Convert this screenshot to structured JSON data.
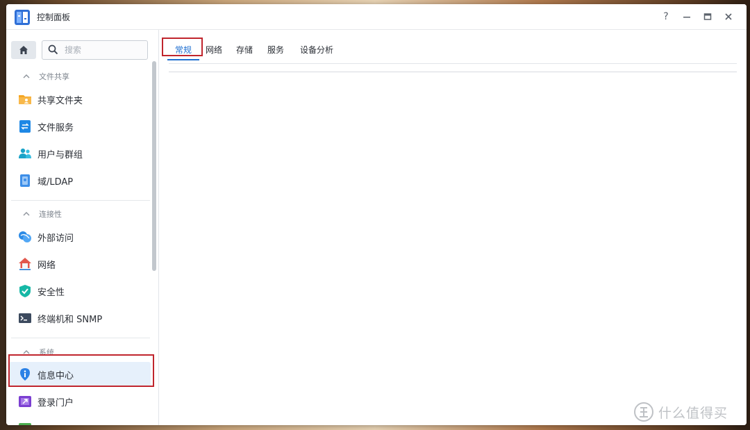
{
  "window": {
    "title": "控制面板",
    "help_label": "?"
  },
  "search": {
    "placeholder": "搜索"
  },
  "sidebar": {
    "sections": [
      {
        "title": "文件共享",
        "items": [
          {
            "label": "共享文件夹",
            "icon": "shared-folder-icon"
          },
          {
            "label": "文件服务",
            "icon": "file-services-icon"
          },
          {
            "label": "用户与群组",
            "icon": "users-groups-icon"
          },
          {
            "label": "域/LDAP",
            "icon": "domain-ldap-icon"
          }
        ]
      },
      {
        "title": "连接性",
        "items": [
          {
            "label": "外部访问",
            "icon": "external-access-icon"
          },
          {
            "label": "网络",
            "icon": "network-icon"
          },
          {
            "label": "安全性",
            "icon": "security-shield-icon"
          },
          {
            "label": "终端机和 SNMP",
            "icon": "terminal-icon"
          }
        ]
      },
      {
        "title": "系统",
        "items": [
          {
            "label": "信息中心",
            "icon": "info-center-icon",
            "active": true
          },
          {
            "label": "登录门户",
            "icon": "login-portal-icon"
          }
        ]
      }
    ]
  },
  "tabs": [
    {
      "label": "常规",
      "active": true
    },
    {
      "label": "网络"
    },
    {
      "label": "存储"
    },
    {
      "label": "服务"
    },
    {
      "label": "设备分析"
    }
  ],
  "watermark": {
    "text": "什么值得买",
    "logo_char": "值"
  },
  "colors": {
    "accent": "#1f6fd1",
    "highlight_box": "#c0252d",
    "active_item_bg": "#e6f0fb"
  }
}
